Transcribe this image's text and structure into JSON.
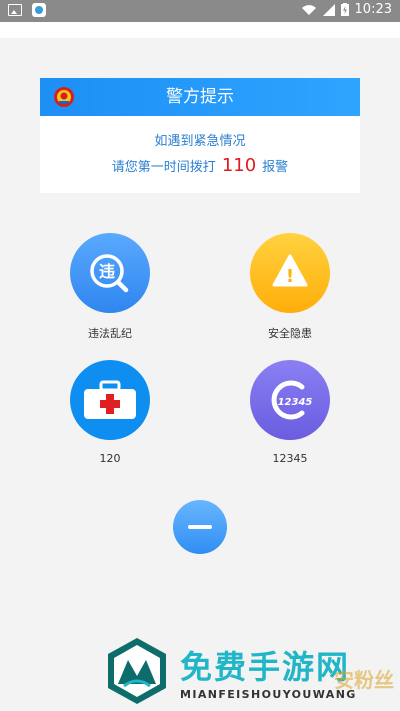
{
  "status_bar": {
    "time": "10:23"
  },
  "notice": {
    "title": "警方提示",
    "line1": "如遇到紧急情况",
    "line2_prefix": "请您第一时间拨打",
    "line2_number": "110",
    "line2_suffix": "报警"
  },
  "tiles": [
    {
      "label": "违法乱纪",
      "icon_text": "违"
    },
    {
      "label": "安全隐患",
      "icon_text": "!"
    },
    {
      "label": "120",
      "icon_text": "+"
    },
    {
      "label": "12345",
      "icon_text": "12345"
    }
  ],
  "watermark": {
    "title": "免费手游网",
    "subtitle": "MIANFEISHOUYOUWANG",
    "corner": "安粉丝"
  },
  "colors": {
    "header_blue": "#1d8ff5",
    "text_blue": "#2b7fd2",
    "emergency_red": "#e11b1b",
    "tile_blue": "#3a8ff0",
    "tile_yellow": "#ffbe1a",
    "tile_purple": "#7a6ee8"
  }
}
